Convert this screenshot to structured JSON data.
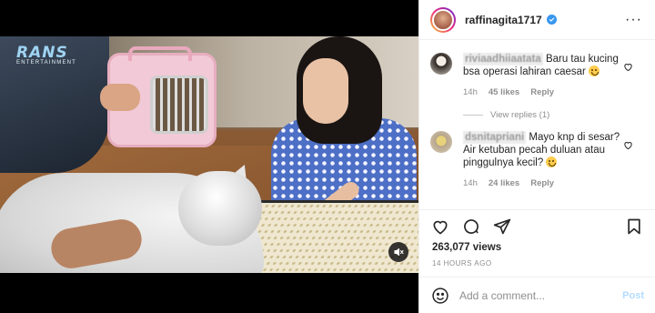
{
  "header": {
    "username": "raffinagita1717",
    "verified_icon": "verified-badge-icon",
    "more_icon": "more-options-icon",
    "more_label": "···"
  },
  "video": {
    "watermark_logo": "RANS",
    "watermark_sub": "ENTERTAINMENT",
    "mute_icon": "speaker-muted-icon"
  },
  "comments": [
    {
      "username": "riviaadhiiaatata",
      "text": "Baru tau kucing bsa operasi lahiran caesar",
      "emoji": "sad-face-emoji",
      "time": "14h",
      "likes": "45 likes",
      "reply": "Reply",
      "heart_icon": "heart-outline-icon"
    },
    {
      "username": "dsnitapriani",
      "text": "Mayo knp di sesar? Air ketuban pecah duluan atau pinggulnya kecil?",
      "emoji": "grinning-sweat-emoji",
      "time": "14h",
      "likes": "24 likes",
      "reply": "Reply",
      "heart_icon": "heart-outline-icon"
    }
  ],
  "view_replies": "View replies (1)",
  "actions": {
    "like_icon": "heart-icon",
    "comment_icon": "comment-icon",
    "share_icon": "paper-plane-icon",
    "save_icon": "bookmark-icon"
  },
  "stats": {
    "views": "263,077 views",
    "time_ago": "14 HOURS AGO"
  },
  "composer": {
    "emoji_icon": "smiley-icon",
    "placeholder": "Add a comment...",
    "post_label": "Post"
  },
  "colors": {
    "verified": "#3897f0",
    "post_button_disabled": "#b3dbff",
    "muted_text": "#8e8e8e"
  }
}
